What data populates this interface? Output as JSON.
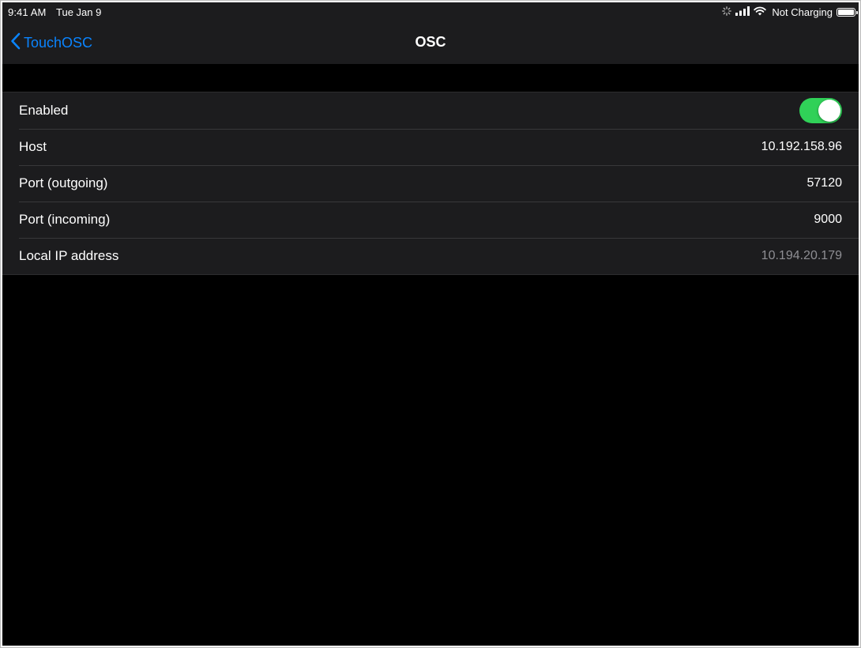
{
  "status_bar": {
    "time": "9:41 AM",
    "date": "Tue Jan 9",
    "battery_text": "Not Charging",
    "icons": [
      "activity-spinner-icon",
      "cellular-signal-icon",
      "wifi-icon",
      "battery-icon"
    ]
  },
  "nav": {
    "back_label": "TouchOSC",
    "title": "OSC"
  },
  "settings": {
    "rows": [
      {
        "label": "Enabled",
        "type": "toggle",
        "on": true
      },
      {
        "label": "Host",
        "value": "10.192.158.96"
      },
      {
        "label": "Port (outgoing)",
        "value": "57120"
      },
      {
        "label": "Port (incoming)",
        "value": "9000"
      },
      {
        "label": "Local IP address",
        "value": "10.194.20.179"
      }
    ]
  },
  "colors": {
    "accent": "#0a84ff",
    "toggle_on": "#30d158",
    "background": "#000000",
    "cell": "#1c1c1e",
    "secondary_text": "#8e8e93"
  }
}
